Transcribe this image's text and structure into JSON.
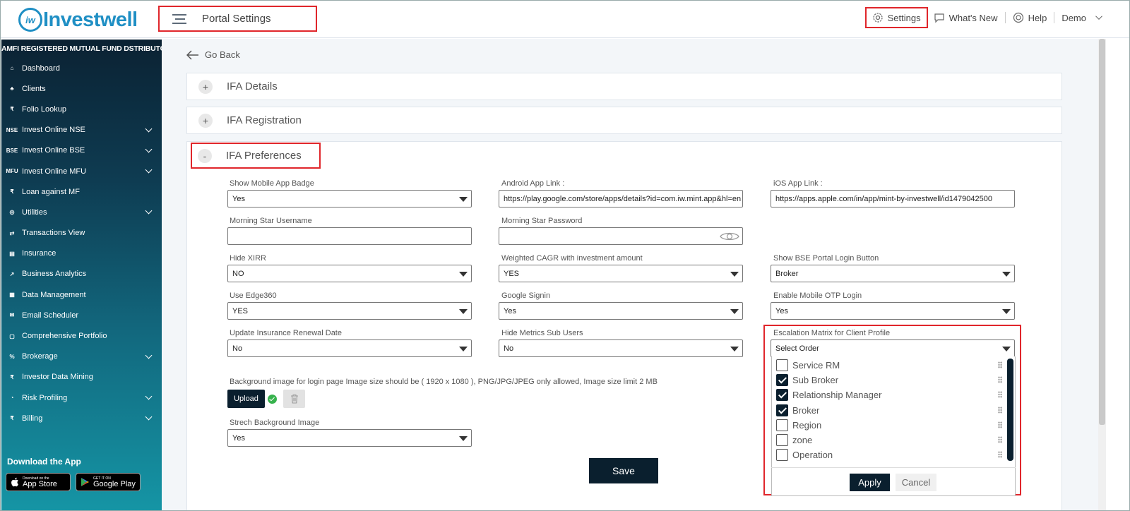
{
  "header": {
    "logo_badge": "iw",
    "logo_text": "Investwell",
    "portal_title": "Portal Settings",
    "nav": {
      "settings": "Settings",
      "whats_new": "What's New",
      "help": "Help",
      "user": "Demo"
    }
  },
  "sidebar": {
    "title": "AMFI REGISTERED MUTUAL FUND DSTRIBUTOR",
    "items": [
      {
        "label": "Dashboard",
        "icon": "home-icon",
        "glyph": "⌂",
        "chevron": false
      },
      {
        "label": "Clients",
        "icon": "users-icon",
        "glyph": "♣",
        "chevron": false
      },
      {
        "label": "Folio Lookup",
        "icon": "folio-icon",
        "glyph": "₹",
        "chevron": false
      },
      {
        "label": "Invest Online NSE",
        "icon": "nse-icon",
        "glyph": "NSE",
        "chevron": true
      },
      {
        "label": "Invest Online BSE",
        "icon": "bse-icon",
        "glyph": "BSE",
        "chevron": true
      },
      {
        "label": "Invest Online MFU",
        "icon": "mfu-icon",
        "glyph": "MFU",
        "chevron": true
      },
      {
        "label": "Loan against MF",
        "icon": "loan-icon",
        "glyph": "₹",
        "chevron": false
      },
      {
        "label": "Utilities",
        "icon": "utilities-icon",
        "glyph": "◎",
        "chevron": true
      },
      {
        "label": "Transactions View",
        "icon": "transactions-icon",
        "glyph": "⇄",
        "chevron": false
      },
      {
        "label": "Insurance",
        "icon": "insurance-icon",
        "glyph": "▤",
        "chevron": false
      },
      {
        "label": "Business Analytics",
        "icon": "analytics-icon",
        "glyph": "↗",
        "chevron": false
      },
      {
        "label": "Data Management",
        "icon": "data-icon",
        "glyph": "▦",
        "chevron": false
      },
      {
        "label": "Email Scheduler",
        "icon": "email-icon",
        "glyph": "✉",
        "chevron": false
      },
      {
        "label": "Comprehensive Portfolio",
        "icon": "portfolio-icon",
        "glyph": "▢",
        "chevron": false
      },
      {
        "label": "Brokerage",
        "icon": "brokerage-icon",
        "glyph": "%",
        "chevron": true
      },
      {
        "label": "Investor Data Mining",
        "icon": "mining-icon",
        "glyph": "₹",
        "chevron": false
      },
      {
        "label": "Risk Profiling",
        "icon": "risk-icon",
        "glyph": "◔",
        "chevron": true
      },
      {
        "label": "Billing",
        "icon": "billing-icon",
        "glyph": "₹",
        "chevron": true
      }
    ],
    "download_label": "Download the App",
    "app_store": {
      "small": "Download on the",
      "big": "App Store"
    },
    "google_play": {
      "small": "GET IT ON",
      "big": "Google Play"
    }
  },
  "main": {
    "go_back": "Go Back",
    "sections": [
      {
        "title": "IFA Details",
        "toggle": "+"
      },
      {
        "title": "IFA Registration",
        "toggle": "+"
      },
      {
        "title": "IFA Preferences",
        "toggle": "-"
      }
    ],
    "fields": {
      "show_mobile_app_badge": {
        "label": "Show Mobile App Badge",
        "value": "Yes"
      },
      "android_app_link": {
        "label": "Android App Link :",
        "value": "https://play.google.com/store/apps/details?id=com.iw.mint.app&hl=en"
      },
      "ios_app_link": {
        "label": "iOS App Link :",
        "value": "https://apps.apple.com/in/app/mint-by-investwell/id1479042500"
      },
      "morning_star_username": {
        "label": "Morning Star Username",
        "value": ""
      },
      "morning_star_password": {
        "label": "Morning Star Password",
        "value": ""
      },
      "hide_xirr": {
        "label": "Hide XIRR",
        "value": "NO"
      },
      "weighted_cagr": {
        "label": "Weighted CAGR with investment amount",
        "value": "YES"
      },
      "show_bse_login": {
        "label": "Show BSE Portal Login Button",
        "value": "Broker"
      },
      "use_edge360": {
        "label": "Use Edge360",
        "value": "YES"
      },
      "google_signin": {
        "label": "Google Signin",
        "value": "Yes"
      },
      "enable_mobile_otp": {
        "label": "Enable Mobile OTP Login",
        "value": "Yes"
      },
      "update_insurance": {
        "label": "Update Insurance Renewal Date",
        "value": "No"
      },
      "hide_metrics": {
        "label": "Hide Metrics Sub Users",
        "value": "No"
      },
      "escalation_matrix": {
        "label": "Escalation Matrix for Client Profile",
        "value": "Select Order"
      },
      "background_image": {
        "label": "Background image for login page Image size should be ( 1920 x 1080 ), PNG/JPG/JPEG only allowed, Image size limit 2 MB"
      },
      "stretch_background": {
        "label": "Strech Background Image",
        "value": "Yes"
      }
    },
    "upload_label": "Upload",
    "save_label": "Save",
    "escalation_options": [
      {
        "label": "Service RM",
        "checked": false
      },
      {
        "label": "Sub Broker",
        "checked": true
      },
      {
        "label": "Relationship Manager",
        "checked": true
      },
      {
        "label": "Broker",
        "checked": true
      },
      {
        "label": "Region",
        "checked": false
      },
      {
        "label": "zone",
        "checked": false
      },
      {
        "label": "Operation",
        "checked": false
      }
    ],
    "apply_label": "Apply",
    "cancel_label": "Cancel"
  }
}
